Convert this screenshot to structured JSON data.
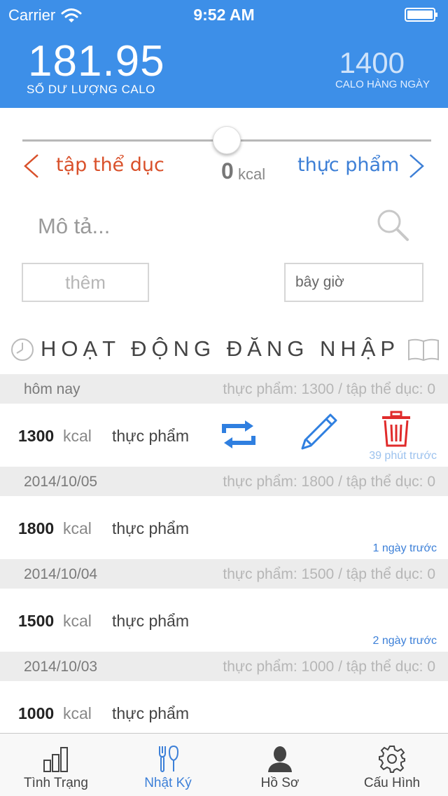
{
  "status_bar": {
    "carrier": "Carrier",
    "time": "9:52 AM"
  },
  "header": {
    "balance_value": "181.95",
    "balance_label": "SỐ DƯ LƯỢNG CALO",
    "daily_value": "1400",
    "daily_label": "CALO HÀNG NGÀY"
  },
  "slider": {
    "left_label": "tập thể dục",
    "right_label": "thực phẩm",
    "value": "0",
    "unit": "kcal",
    "position": 0.5
  },
  "search": {
    "placeholder": "Mô tả..."
  },
  "add_button": "thêm",
  "time_field": "bây giờ",
  "log": {
    "title": "HOẠT ĐỘNG ĐĂNG NHẬP",
    "days": [
      {
        "date": "hôm nay",
        "summary": "thực phẩm: 1300 / tập thể dục: 0",
        "entry": {
          "kcal": "1300",
          "unit": "kcal",
          "type": "thực phẩm",
          "ago": "39 phút trước"
        }
      },
      {
        "date": "2014/10/05",
        "summary": "thực phẩm: 1800 / tập thể dục: 0",
        "entry": {
          "kcal": "1800",
          "unit": "kcal",
          "type": "thực phẩm",
          "ago": "1 ngày trước"
        }
      },
      {
        "date": "2014/10/04",
        "summary": "thực phẩm: 1500 / tập thể dục: 0",
        "entry": {
          "kcal": "1500",
          "unit": "kcal",
          "type": "thực phẩm",
          "ago": "2 ngày trước"
        }
      },
      {
        "date": "2014/10/03",
        "summary": "thực phẩm: 1000 / tập thể dục: 0",
        "entry": {
          "kcal": "1000",
          "unit": "kcal",
          "type": "thực phẩm",
          "ago": ""
        }
      }
    ]
  },
  "tabs": [
    {
      "label": "Tình Trạng",
      "icon": "bar-chart-icon"
    },
    {
      "label": "Nhật Ký",
      "icon": "fork-knife-icon"
    },
    {
      "label": "Hồ Sơ",
      "icon": "person-icon"
    },
    {
      "label": "Cấu Hình",
      "icon": "gear-icon"
    }
  ],
  "colors": {
    "header_bg": "#3d8fe8",
    "exercise": "#d9502a",
    "food": "#3d7fd6",
    "delete": "#e02b2b",
    "active_tab": "#3d80d8"
  }
}
